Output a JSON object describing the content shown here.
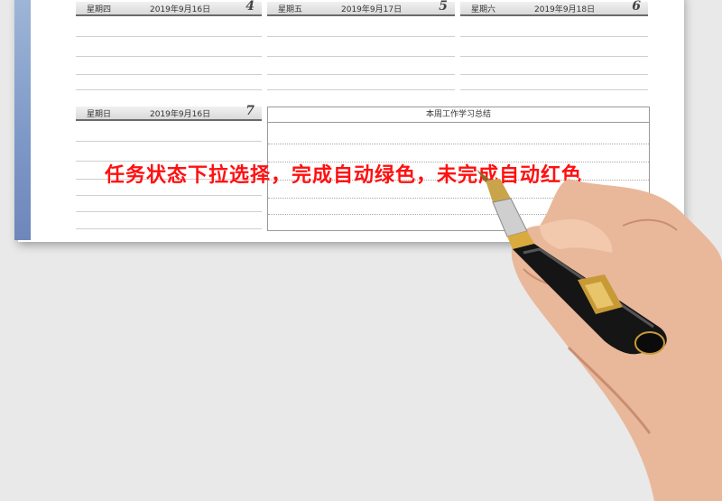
{
  "top_row": [
    {
      "weekday": "星期四",
      "date": "2019年9月16日",
      "num": "4"
    },
    {
      "weekday": "星期五",
      "date": "2019年9月17日",
      "num": "5"
    },
    {
      "weekday": "星期六",
      "date": "2019年9月18日",
      "num": "6"
    }
  ],
  "bottom_left": {
    "weekday": "星期日",
    "date": "2019年9月16日",
    "num": "7"
  },
  "summary": {
    "title": "本周工作学习总结"
  },
  "banner": {
    "text": "任务状态下拉选择，完成自动绿色，未完成自动红色"
  },
  "colors": {
    "banner": "#ff1010",
    "stripe": "#7d97c6",
    "header_border": "#6a6a6a"
  }
}
